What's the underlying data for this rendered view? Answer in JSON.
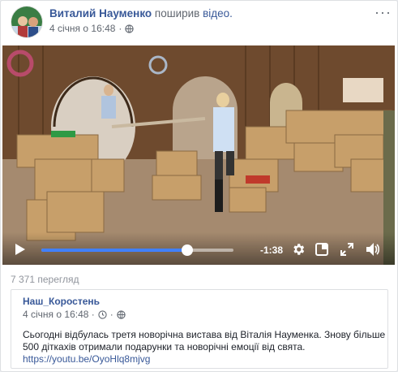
{
  "post": {
    "author": "Виталий Науменко",
    "action": "поширив",
    "action_object": "відео.",
    "timestamp": "4 січня о 16:48",
    "privacy_icon": "globe-icon",
    "more_icon": "more-options-icon"
  },
  "video": {
    "play_icon": "play-icon",
    "progress": 0.76,
    "time_remaining": "-1:38",
    "settings_icon": "gear-icon",
    "pip_icon": "picture-in-picture-icon",
    "fullscreen_icon": "fullscreen-icon",
    "volume_icon": "volume-icon"
  },
  "stats": {
    "views": "7 371 перегляд"
  },
  "shared_post": {
    "source": "Наш_Коростень",
    "timestamp": "4 січня о 16:48 ·",
    "text": "Сьогодні відбулась третя новорічна вистава від Віталія Науменка. Знову більше 500 діткахів отримали подарунки та новорічні емоції від свята.",
    "link": "https://youtu.be/OyoHlq8mjvg"
  },
  "colors": {
    "accent": "#4080ff",
    "link": "#385898",
    "muted": "#616770"
  }
}
